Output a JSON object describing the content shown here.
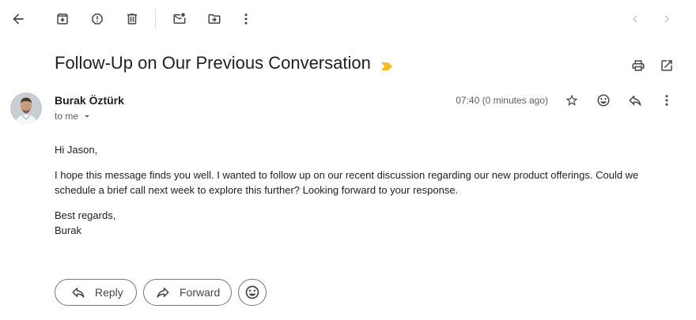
{
  "toolbar": {
    "back_icon": "arrow-back-icon",
    "archive_icon": "archive-icon",
    "spam_icon": "report-spam-icon",
    "delete_icon": "trash-icon",
    "mark_unread_icon": "mark-unread-icon",
    "move_to_icon": "move-to-folder-icon",
    "more_icon": "more-vertical-icon",
    "prev_icon": "chevron-left-icon",
    "next_icon": "chevron-right-icon"
  },
  "email": {
    "subject": "Follow-Up on Our Previous Conversation",
    "sender_name": "Burak Öztürk",
    "recipient": "to me",
    "timestamp": "07:40 (0 minutes ago)",
    "greeting": "Hi Jason,",
    "paragraph": "I hope this message finds you well. I wanted to follow up on our recent discussion regarding our new product offerings. Could we schedule a brief call next week to explore this further? Looking forward to your response.",
    "closing": "Best regards,",
    "signature": "Burak"
  },
  "actions": {
    "reply_label": "Reply",
    "forward_label": "Forward"
  },
  "colors": {
    "importance_marker": "#f6bf26",
    "icon": "#444746",
    "border": "#747775"
  }
}
